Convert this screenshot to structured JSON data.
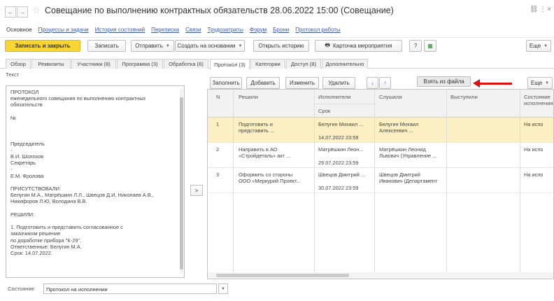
{
  "window": {
    "title": "Совещание по выполнению контрактных обязательств 28.06.2022 15:00 (Совещание)",
    "controls": [
      "⛓",
      "⋮",
      "×"
    ]
  },
  "sections": [
    "Основное",
    "Процессы и задачи",
    "История состояний",
    "Переписка",
    "Связи",
    "Трудозатраты",
    "Форум",
    "Брони",
    "Протокол работы"
  ],
  "toolbar": {
    "save_close": "Записать и закрыть",
    "save": "Записать",
    "send": "Отправить",
    "create_based": "Создать на основании",
    "open_history": "Открыть историю",
    "event_card": "Карточка мероприятия",
    "more": "Еще"
  },
  "tabs": [
    "Обзор",
    "Реквизиты",
    "Участники (8)",
    "Программа (3)",
    "Обработка (6)",
    "Протокол (3)",
    "Категории",
    "Доступ (8)",
    "Дополнительно"
  ],
  "text_panel": {
    "label": "Текст",
    "lines": [
      "ПРОТОКОЛ",
      "еженедельного совещания по выполнению контрактных",
      "обязательств",
      "",
      "№",
      "",
      "",
      "",
      "Председатель",
      "-",
      "В.И. Шолохов",
      "Секретарь",
      "-",
      "Е.М. Фролова",
      "",
      "ПРИСУТСТВОВАЛИ:",
      "Белугин М.А., Матрёшкин Л.Л., Швецов Д.И, Николаев А.В.,",
      "Никифоров Л.Ю, Володина В.В.",
      "",
      "РЕШИЛИ:",
      "",
      "   1. Подготовить и представить согласованное с",
      "заказчиком решение",
      "по доработке прибора \"К-29\".",
      "    Ответственные: Белугин М.А.",
      "    Срок: 14.07.2022."
    ]
  },
  "move_button": ">",
  "table_toolbar": {
    "fill": "Заполнить",
    "add": "Добавить",
    "edit": "Изменить",
    "delete": "Удалить",
    "down": "↓",
    "up": "↑",
    "from_file": "Взять из файла",
    "more": "Еще"
  },
  "table": {
    "headers": {
      "n": "N",
      "decided": "Решили",
      "executors": "Исполнители",
      "deadline": "Срок",
      "heard": "Слушали",
      "speakers": "Выступили",
      "status": "Состояние исполнения"
    },
    "rows": [
      {
        "n": "1",
        "decided": [
          "Подготовить и",
          "представить ..."
        ],
        "executor": "Белугин Михаил ...",
        "deadline": "14.07.2022 23:59",
        "heard": [
          "Белугин Михаил",
          "Алексеевич ..."
        ],
        "speakers": "",
        "status": "На испо"
      },
      {
        "n": "2",
        "decided": [
          "Направить в АО",
          "«Стройдеталь» акт ..."
        ],
        "executor": "Матрёшкин Леон...",
        "deadline": "29.07.2022 23:59",
        "heard": [
          "Матрёшкин Леонид",
          "Львович (Управление ..."
        ],
        "speakers": "",
        "status": "На испо"
      },
      {
        "n": "3",
        "decided": [
          "Оформить со стороны",
          "ООО «Меркурий Проект..."
        ],
        "executor": "Швецов Дмитрий ...",
        "deadline": "30.07.2022 23:59",
        "heard": [
          "Швецов Дмитрий",
          "Иванович (Департамент"
        ],
        "speakers": "",
        "status": "На испо"
      }
    ]
  },
  "status": {
    "label": "Состояние:",
    "value": "Протокол на исполнении"
  },
  "colors": {
    "primary_button": "#f6d535",
    "selected_row": "#fbefc3",
    "arrow": "#e01010",
    "link": "#3a5aa8"
  }
}
